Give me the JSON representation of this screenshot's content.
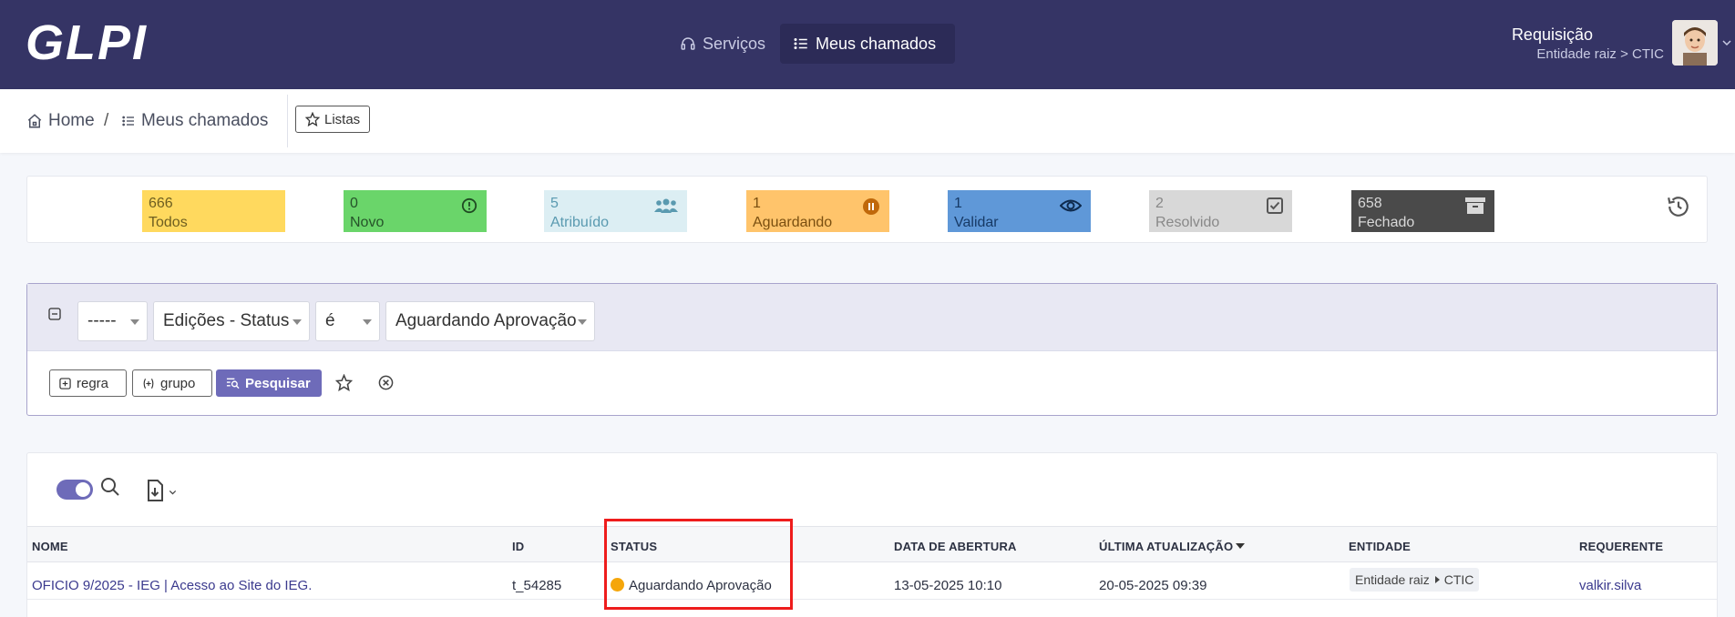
{
  "header": {
    "logo": "GLPI",
    "nav": {
      "services": "Serviços",
      "my_tickets": "Meus chamados"
    },
    "user": {
      "profile": "Requisição",
      "entity": "Entidade raiz > CTIC"
    }
  },
  "breadcrumb": {
    "home": "Home",
    "separator": "/",
    "current": "Meus chamados",
    "lists_button": "Listas"
  },
  "status_tiles": [
    {
      "count": "666",
      "label": "Todos",
      "color": "#ffd95e"
    },
    {
      "count": "0",
      "label": "Novo",
      "color": "#6ad56a"
    },
    {
      "count": "5",
      "label": "Atribuído",
      "color": "#dceef3"
    },
    {
      "count": "1",
      "label": "Aguardando",
      "color": "#ffc46b"
    },
    {
      "count": "1",
      "label": "Validar",
      "color": "#5f98d8"
    },
    {
      "count": "2",
      "label": "Resolvido",
      "color": "#d8d8d8"
    },
    {
      "count": "658",
      "label": "Fechado",
      "color": "#4a4a4a"
    }
  ],
  "search": {
    "criteria": {
      "link": "-----",
      "field": "Edições - Status",
      "operator": "é",
      "value": "Aguardando Aprovação"
    },
    "buttons": {
      "rule": "regra",
      "group": "grupo",
      "search": "Pesquisar"
    }
  },
  "table": {
    "columns": {
      "name": "NOME",
      "id": "ID",
      "status": "STATUS",
      "opened": "DATA DE ABERTURA",
      "updated": "ÚLTIMA ATUALIZAÇÃO",
      "entity": "ENTIDADE",
      "requester": "REQUERENTE"
    },
    "rows": [
      {
        "name": "OFICIO 9/2025 - IEG | Acesso ao Site do IEG.",
        "id": "t_54285",
        "status": "Aguardando Aprovação",
        "opened": "13-05-2025 10:10",
        "updated": "20-05-2025 09:39",
        "entity_root": "Entidade raiz",
        "entity_child": "CTIC",
        "requester": "valkir.silva"
      }
    ]
  },
  "colors": {
    "header_bg": "#353465",
    "accent": "#6e6bb9",
    "highlight": "#ee1c1c",
    "waiting_status": "#f5a60a"
  }
}
